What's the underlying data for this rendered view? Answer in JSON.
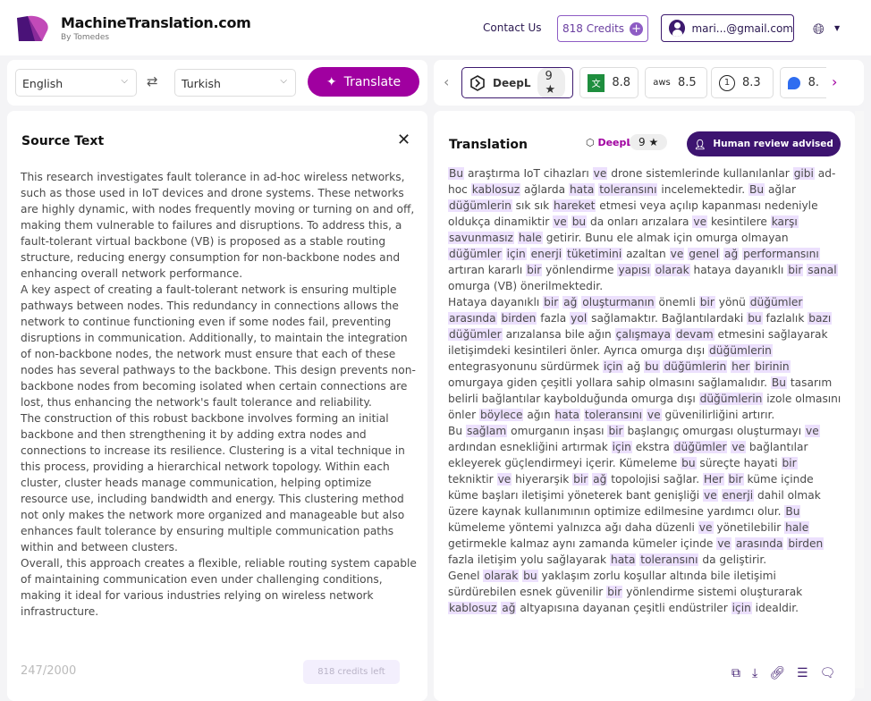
{
  "header": {
    "brand": "MachineTranslation.com",
    "brand_sub": "By Tomedes",
    "contact": "Contact Us",
    "credits": "818 Credits",
    "account": "mari...@gmail.com",
    "language_icon": "globe-icon"
  },
  "toolbar": {
    "source_lang": "English",
    "target_lang": "Turkish",
    "translate_label": "Translate"
  },
  "engines": [
    {
      "name": "DeepL",
      "score": "9",
      "icon": "deepl-icon",
      "active": true
    },
    {
      "name": "",
      "score": "8.8",
      "icon": "google-translate-icon"
    },
    {
      "name": "",
      "score": "8.5",
      "icon": "aws-icon"
    },
    {
      "name": "",
      "score": "8.3",
      "icon": "modernmt-icon"
    },
    {
      "name": "",
      "score": "8.",
      "icon": "engine-icon"
    }
  ],
  "source": {
    "title": "Source Text",
    "count": "247/2000",
    "credits_left": "818 credits left",
    "paragraphs": [
      "This research investigates fault tolerance in ad-hoc wireless networks, such as those used in IoT devices and drone systems. These networks are highly dynamic, with nodes frequently moving or turning on and off, making them vulnerable to failures and disruptions. To address this, a fault-tolerant virtual backbone (VB) is proposed as a stable routing structure, reducing energy consumption for non-backbone nodes and enhancing overall network performance.",
      "A key aspect of creating a fault-tolerant network is ensuring multiple pathways between nodes. This redundancy in connections allows the network to continue functioning even if some nodes fail, preventing disruptions in communication. Additionally, to maintain the integration of non-backbone nodes, the network must ensure that each of these nodes has several pathways to the backbone. This design prevents non-backbone nodes from becoming isolated when certain connections are lost, thus enhancing the network's fault tolerance and reliability.",
      "The construction of this robust backbone involves forming an initial backbone and then strengthening it by adding extra nodes and connections to increase its resilience. Clustering is a vital technique in this process, providing a hierarchical network topology. Within each cluster, cluster heads manage communication, helping optimize resource use, including bandwidth and energy. This clustering method not only makes the network more organized and manageable but also enhances fault tolerance by ensuring multiple communication paths within and between clusters.",
      "Overall, this approach creates a flexible, reliable routing system capable of maintaining communication even under challenging conditions, making it ideal for various industries relying on wireless network infrastructure."
    ]
  },
  "translation": {
    "title": "Translation",
    "engine": "DeepL",
    "score": "9",
    "review_label": "Human review advised",
    "highlight_color": "#ece0fd",
    "paragraphs": [
      [
        [
          "Bu"
        ],
        " araştırma IoT cihazları ",
        [
          "ve"
        ],
        " drone sistemlerinde kullanılanlar ",
        [
          "gibi"
        ],
        " ad-hoc ",
        [
          "kablosuz"
        ],
        " ağlarda ",
        [
          "hata"
        ],
        " ",
        [
          "toleransını"
        ],
        " incelemektedir. ",
        [
          "Bu"
        ],
        " ağlar ",
        [
          "düğümlerin"
        ],
        " sık sık ",
        [
          "hareket"
        ],
        " etmesi veya açılıp kapanması nedeniyle oldukça dinamiktir ",
        [
          "ve"
        ],
        " ",
        [
          "bu"
        ],
        " da onları arızalara ",
        [
          "ve"
        ],
        " kesintilere ",
        [
          "karşı"
        ],
        " ",
        [
          "savunmasız"
        ],
        " ",
        [
          "hale"
        ],
        " getirir. Bunu ele almak için omurga olmayan ",
        [
          "düğümler"
        ],
        " ",
        [
          "için"
        ],
        " ",
        [
          "enerji"
        ],
        " ",
        [
          "tüketimini"
        ],
        " azaltan ",
        [
          "ve"
        ],
        " ",
        [
          "genel"
        ],
        " ",
        [
          "ağ"
        ],
        " ",
        [
          "performansını"
        ],
        " artıran kararlı ",
        [
          "bir"
        ],
        " yönlendirme ",
        [
          "yapısı"
        ],
        " ",
        [
          "olarak"
        ],
        " hataya dayanıklı ",
        [
          "bir"
        ],
        " ",
        [
          "sanal"
        ],
        " omurga (VB) önerilmektedir."
      ],
      [
        "Hataya dayanıklı ",
        [
          "bir"
        ],
        " ",
        [
          "ağ"
        ],
        " ",
        [
          "oluşturmanın"
        ],
        " önemli ",
        [
          "bir"
        ],
        " yönü ",
        [
          "düğümler"
        ],
        " ",
        [
          "arasında"
        ],
        " ",
        [
          "birden"
        ],
        " fazla ",
        [
          "yol"
        ],
        " sağlamaktır. Bağlantılardaki ",
        [
          "bu"
        ],
        " fazlalık ",
        [
          "bazı"
        ],
        " ",
        [
          "düğümler"
        ],
        " arızalansa bile ağın ",
        [
          "çalışmaya"
        ],
        " ",
        [
          "devam"
        ],
        " etmesini sağlayarak iletişimdeki kesintileri önler. Ayrıca omurga dışı ",
        [
          "düğümlerin"
        ],
        " entegrasyonunu sürdürmek ",
        [
          "için"
        ],
        " ağ ",
        [
          "bu"
        ],
        " ",
        [
          "düğümlerin"
        ],
        " ",
        [
          "her"
        ],
        " ",
        [
          "birinin"
        ],
        " omurgaya giden çeşitli yollara sahip olmasını sağlamalıdır. ",
        [
          "Bu"
        ],
        " tasarım belirli bağlantılar kaybolduğunda omurga dışı ",
        [
          "düğümlerin"
        ],
        " izole olmasını önler ",
        [
          "böylece"
        ],
        " ağın ",
        [
          "hata"
        ],
        " ",
        [
          "toleransını"
        ],
        " ",
        [
          "ve"
        ],
        " güvenilirliğini artırır."
      ],
      [
        "Bu ",
        [
          "sağlam"
        ],
        " omurganın inşası ",
        [
          "bir"
        ],
        " başlangıç omurgası oluşturmayı ",
        [
          "ve"
        ],
        " ardından esnekliğini artırmak ",
        [
          "için"
        ],
        " ekstra ",
        [
          "düğümler"
        ],
        " ",
        [
          "ve"
        ],
        " bağlantılar ekleyerek güçlendirmeyi içerir. Kümeleme ",
        [
          "bu"
        ],
        " süreçte hayati ",
        [
          "bir"
        ],
        " tekniktir ",
        [
          "ve"
        ],
        " hiyerarşik ",
        [
          "bir"
        ],
        " ",
        [
          "ağ"
        ],
        " topolojisi sağlar. ",
        [
          "Her"
        ],
        " ",
        [
          "bir"
        ],
        " küme içinde küme başları iletişimi yöneterek bant genişliği ",
        [
          "ve"
        ],
        " ",
        [
          "enerji"
        ],
        " dahil olmak üzere kaynak kullanımının optimize edilmesine yardımcı olur. ",
        [
          "Bu"
        ],
        " kümeleme yöntemi yalnızca ağı daha düzenli ",
        [
          "ve"
        ],
        " yönetilebilir ",
        [
          "hale"
        ],
        " getirmekle kalmaz aynı zamanda kümeler içinde ",
        [
          "ve"
        ],
        " ",
        [
          "arasında"
        ],
        " ",
        [
          "birden"
        ],
        " fazla iletişim yolu sağlayarak ",
        [
          "hata"
        ],
        " ",
        [
          "toleransını"
        ],
        " da geliştirir."
      ],
      [
        "Genel ",
        [
          "olarak"
        ],
        " ",
        [
          "bu"
        ],
        " yaklaşım zorlu koşullar altında bile iletişimi sürdürebilen esnek güvenilir ",
        [
          "bir"
        ],
        " yönlendirme sistemi oluşturarak ",
        [
          "kablosuz"
        ],
        " ",
        [
          "ağ"
        ],
        " altyapısına dayanan çeşitli endüstriler ",
        [
          "için"
        ],
        " idealdir."
      ]
    ],
    "tools": [
      "copy-icon",
      "download-icon",
      "link-icon",
      "compare-icon",
      "feedback-icon"
    ]
  },
  "colors": {
    "accent": "#a000a0",
    "dark_purple": "#3d1470"
  }
}
